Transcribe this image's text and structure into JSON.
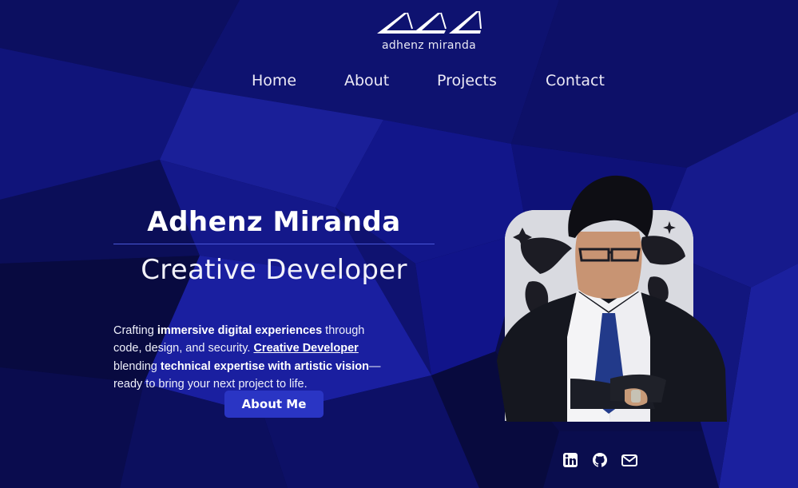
{
  "brand": {
    "name": "adhenz miranda",
    "logo_icon": "triple-triangle-logo-icon"
  },
  "nav": {
    "items": [
      {
        "label": "Home"
      },
      {
        "label": "About"
      },
      {
        "label": "Projects"
      },
      {
        "label": "Contact"
      }
    ]
  },
  "hero": {
    "name": "Adhenz Miranda",
    "role": "Creative Developer",
    "description": {
      "p1": "Crafting ",
      "b1": "immersive digital experiences",
      "p2": " through code, design, and security. ",
      "link": "Creative Developer",
      "p3": " blending ",
      "b2": "technical expertise with artistic vision",
      "p4": "— ready to bring your next project to life."
    },
    "cta_label": "About Me"
  },
  "portrait": {
    "subject": "portrait-photo"
  },
  "socials": [
    {
      "icon": "linkedin-icon"
    },
    {
      "icon": "github-icon"
    },
    {
      "icon": "mail-icon"
    }
  ],
  "colors": {
    "background": "#0a0c4a",
    "accent": "#2a35c4",
    "divider": "#4a57d8",
    "text": "#ffffff"
  }
}
